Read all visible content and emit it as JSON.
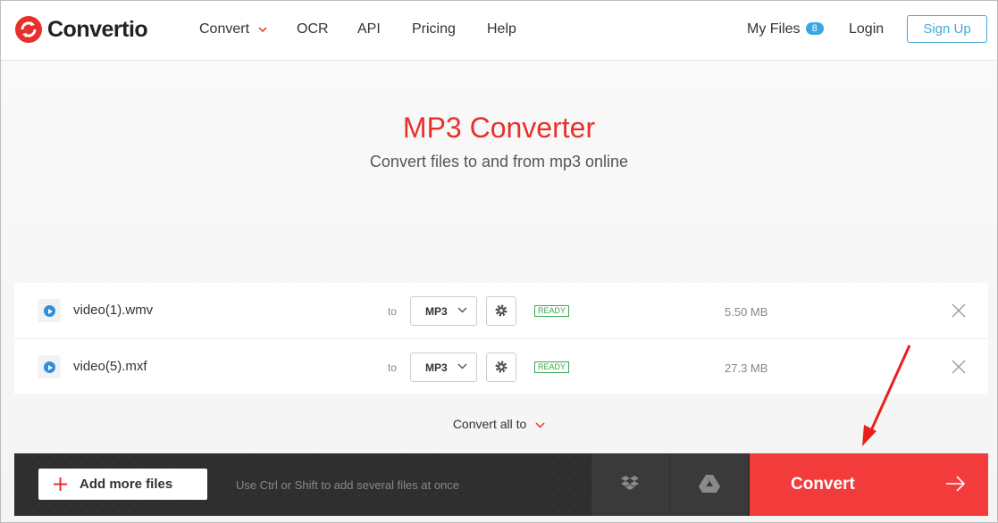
{
  "brand": {
    "name": "Convertio",
    "accent": "#e8302b"
  },
  "nav": {
    "convert": "Convert",
    "ocr": "OCR",
    "api": "API",
    "pricing": "Pricing",
    "help": "Help",
    "my_files": "My Files",
    "my_files_count": "8",
    "login": "Login",
    "signup": "Sign Up"
  },
  "hero": {
    "title": "MP3 Converter",
    "subtitle": "Convert files to and from mp3 online"
  },
  "files": [
    {
      "name": "video(1).wmv",
      "to": "to",
      "format": "MP3",
      "status": "READY",
      "size": "5.50 MB"
    },
    {
      "name": "video(5).mxf",
      "to": "to",
      "format": "MP3",
      "status": "READY",
      "size": "27.3 MB"
    }
  ],
  "convert_all": "Convert all to",
  "actions": {
    "add_more": "Add more files",
    "hint": "Use Ctrl or Shift to add several files at once",
    "dropbox_icon": "dropbox-icon",
    "gdrive_icon": "google-drive-icon",
    "convert": "Convert"
  }
}
